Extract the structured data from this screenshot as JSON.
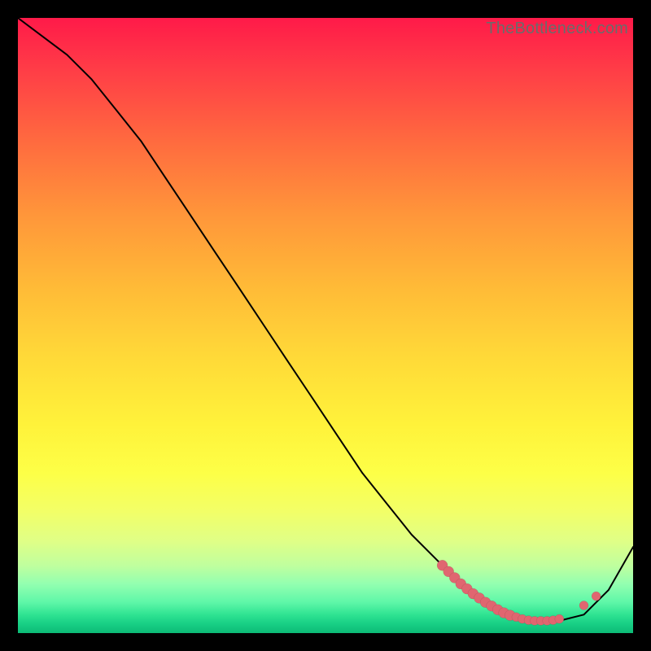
{
  "watermark": "TheBottleneck.com",
  "colors": {
    "marker": "#e06670",
    "curve": "#000000"
  },
  "chart_data": {
    "type": "line",
    "title": "",
    "xlabel": "",
    "ylabel": "",
    "xlim": [
      0,
      100
    ],
    "ylim": [
      0,
      100
    ],
    "grid": false,
    "legend": false,
    "series": [
      {
        "name": "bottleneck-curve",
        "x": [
          0,
          4,
          8,
          12,
          16,
          20,
          24,
          28,
          32,
          36,
          40,
          44,
          48,
          52,
          56,
          60,
          64,
          68,
          72,
          76,
          80,
          84,
          88,
          92,
          96,
          100
        ],
        "y": [
          100,
          97,
          94,
          90,
          85,
          80,
          74,
          68,
          62,
          56,
          50,
          44,
          38,
          32,
          26,
          21,
          16,
          12,
          8,
          5,
          3,
          2,
          2,
          3,
          7,
          14
        ]
      }
    ],
    "markers": {
      "name": "highlighted-points",
      "points": [
        {
          "x": 69,
          "y": 11.0
        },
        {
          "x": 70,
          "y": 10.0
        },
        {
          "x": 71,
          "y": 9.0
        },
        {
          "x": 72,
          "y": 8.0
        },
        {
          "x": 73,
          "y": 7.2
        },
        {
          "x": 74,
          "y": 6.4
        },
        {
          "x": 75,
          "y": 5.7
        },
        {
          "x": 76,
          "y": 5.0
        },
        {
          "x": 77,
          "y": 4.4
        },
        {
          "x": 78,
          "y": 3.8
        },
        {
          "x": 79,
          "y": 3.3
        },
        {
          "x": 80,
          "y": 2.9
        },
        {
          "x": 81,
          "y": 2.6
        },
        {
          "x": 82,
          "y": 2.3
        },
        {
          "x": 83,
          "y": 2.1
        },
        {
          "x": 84,
          "y": 2.0
        },
        {
          "x": 85,
          "y": 2.0
        },
        {
          "x": 86,
          "y": 2.0
        },
        {
          "x": 87,
          "y": 2.1
        },
        {
          "x": 88,
          "y": 2.3
        },
        {
          "x": 92,
          "y": 4.5
        },
        {
          "x": 94,
          "y": 6.0
        }
      ]
    }
  }
}
